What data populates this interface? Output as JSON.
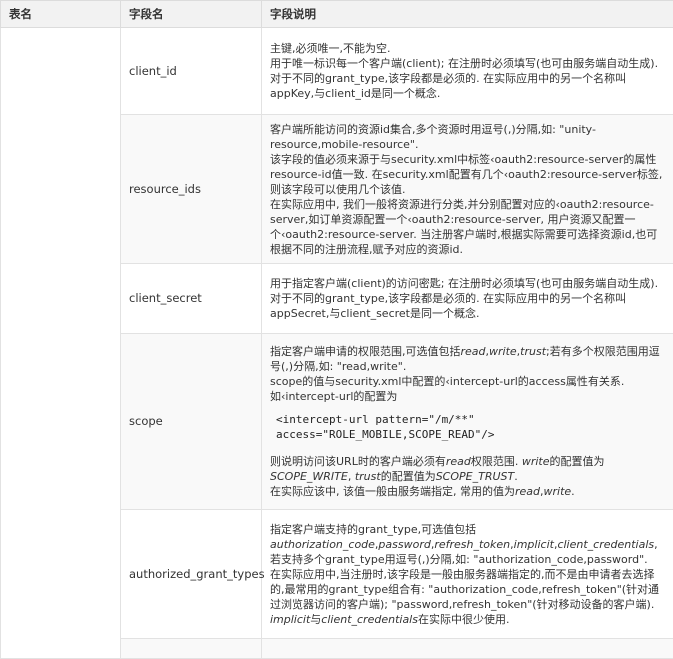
{
  "header": {
    "col1": "表名",
    "col2": "字段名",
    "col3": "字段说明"
  },
  "rows": [
    {
      "name": "client_id",
      "lines": [
        "主键,必须唯一,不能为空.",
        "用于唯一标识每一个客户端(client); 在注册时必须填写(也可由服务端自动生成).",
        "对于不同的grant_type,该字段都是必须的. 在实际应用中的另一个名称叫appKey,与client_id是同一个概念."
      ]
    },
    {
      "name": "resource_ids",
      "lines": [
        "客户端所能访问的资源id集合,多个资源时用逗号(,)分隔,如: \"unity-resource,mobile-resource\".",
        "该字段的值必须来源于与security.xml中标签‹oauth2:resource-server的属性resource-id值一致. 在security.xml配置有几个‹oauth2:resource-server标签, 则该字段可以使用几个该值.",
        "在实际应用中, 我们一般将资源进行分类,并分别配置对应的‹oauth2:resource-server,如订单资源配置一个‹oauth2:resource-server, 用户资源又配置一个‹oauth2:resource-server. 当注册客户端时,根据实际需要可选择资源id,也可根据不同的注册流程,赋予对应的资源id."
      ]
    },
    {
      "name": "client_secret",
      "lines": [
        "用于指定客户端(client)的访问密匙; 在注册时必须填写(也可由服务端自动生成).",
        "对于不同的grant_type,该字段都是必须的. 在实际应用中的另一个名称叫appSecret,与client_secret是同一个概念."
      ]
    },
    {
      "name": "scope",
      "p1_a": "指定客户端申请的权限范围,可选值包括",
      "p1_read": "read",
      "p1_c1": ",",
      "p1_write": "write",
      "p1_c2": ",",
      "p1_trust": "trust",
      "p1_b": ";若有多个权限范围用逗号(,)分隔,如: \"read,write\".",
      "p2": "scope的值与security.xml中配置的‹intercept-url的access属性有关系.",
      "p3": "如‹intercept-url的配置为",
      "code1": "<intercept-url pattern=\"/m/**\"",
      "code2": "access=\"ROLE_MOBILE,SCOPE_READ\"/>",
      "p4_a": "则说明访问该URL时的客户端必须有",
      "p4_read": "read",
      "p4_b": "权限范围. ",
      "p4_write": "write",
      "p4_c": "的配置值为",
      "p4_sw": "SCOPE_WRITE",
      "p4_d": ", ",
      "p4_trust": "trust",
      "p4_e": "的配置值为",
      "p4_st": "SCOPE_TRUST",
      "p4_f": ".",
      "p5_a": "在实际应该中, 该值一般由服务端指定, 常用的值为",
      "p5_read": "read",
      "p5_c": ",",
      "p5_write": "write",
      "p5_b": "."
    },
    {
      "name": "authorized_grant_types",
      "p1": "指定客户端支持的grant_type,可选值包括",
      "g1": "authorization_code",
      "c1": ",",
      "g2": "password",
      "c2": ",",
      "g3": "refresh_token",
      "c3": ",",
      "g4": "implicit",
      "c4": ",",
      "g5": "client_credentials",
      "p2": ", 若支持多个grant_type用逗号(,)分隔,如: \"authorization_code,password\".",
      "p3": "在实际应用中,当注册时,该字段是一般由服务器端指定的,而不是由申请者去选择的,最常用的grant_type组合有: \"authorization_code,refresh_token\"(针对通过浏览器访问的客户端); \"password,refresh_token\"(针对移动设备的客户端).",
      "g6": "implicit",
      "p4a": "与",
      "g7": "client_credentials",
      "p4b": "在实际中很少使用."
    }
  ]
}
